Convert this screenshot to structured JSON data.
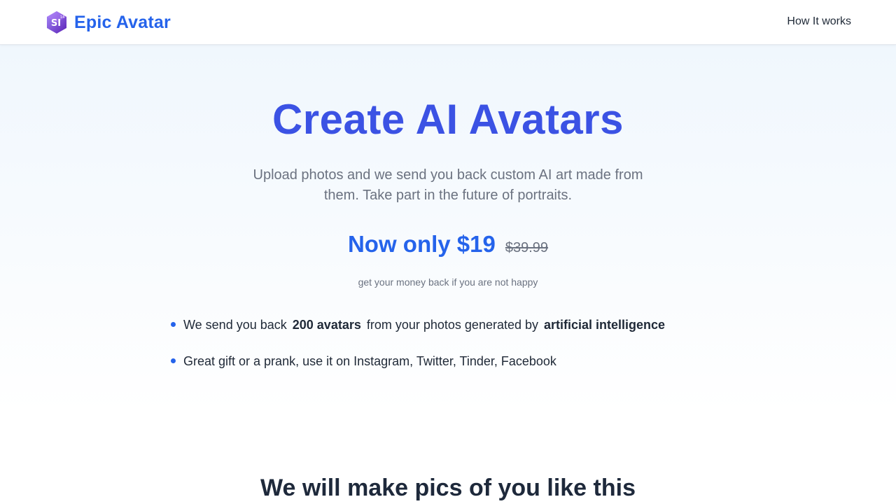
{
  "header": {
    "logo_text": "SI",
    "logo_badge": "14",
    "brand_name": "Epic Avatar",
    "nav_link": "How It works"
  },
  "hero": {
    "headline": "Create AI Avatars",
    "subhead": "Upload photos and we send you back custom AI art made from them. Take part in the future of portraits.",
    "price_now": "Now only $19",
    "price_old": "$39.99",
    "guarantee": "get your money back if you are not happy",
    "features": [
      {
        "pre": "We send you back",
        "bold1": "200 avatars",
        "mid": "from your photos generated by",
        "bold2": "artificial intelligence"
      },
      {
        "text": "Great gift or a prank, use it on Instagram, Twitter, Tinder, Facebook"
      }
    ]
  },
  "section": {
    "title": "We will make pics of you like this"
  },
  "colors": {
    "brand": "#2563eb",
    "headline": "#3b52e4",
    "logo_gradient_start": "#8b5cf6",
    "logo_gradient_end": "#5b21b6"
  }
}
